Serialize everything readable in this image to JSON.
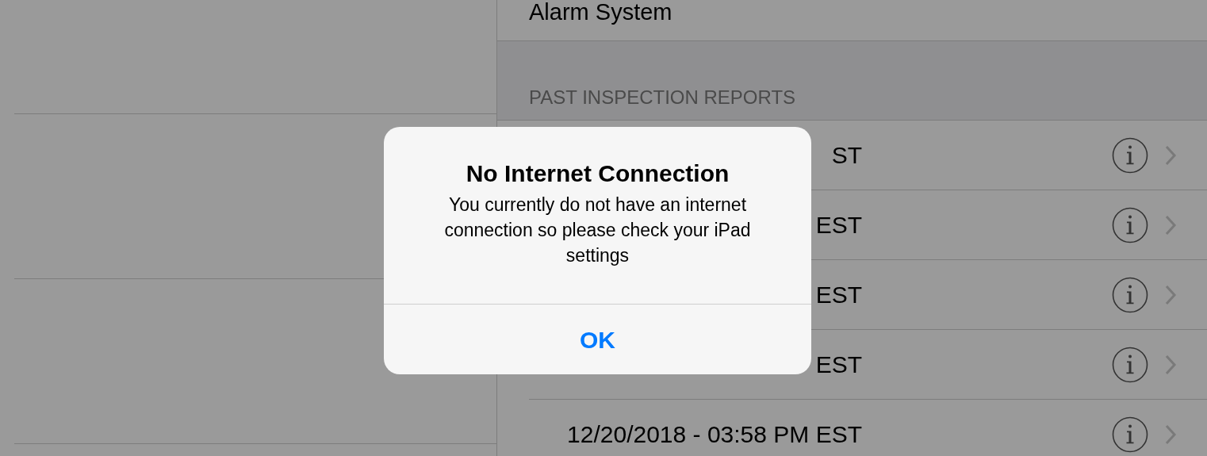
{
  "detail": {
    "top_row": {
      "label": "Alarm System"
    },
    "section_header": "PAST INSPECTION REPORTS",
    "reports": [
      {
        "label": "ST"
      },
      {
        "label": "EST"
      },
      {
        "label": "EST"
      },
      {
        "label": "EST"
      },
      {
        "label": "12/20/2018 - 03:58 PM EST"
      }
    ]
  },
  "alert": {
    "title": "No Internet Connection",
    "message": "You currently do not have an internet connection so please check your iPad settings",
    "button": "OK"
  }
}
